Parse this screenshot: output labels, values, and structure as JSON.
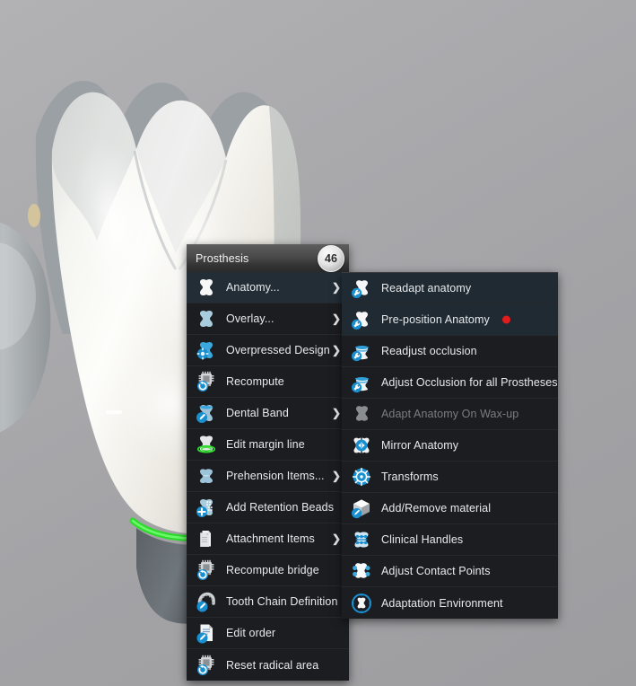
{
  "app": {
    "scene_description": "3D dental CAD viewport showing a molar crown restoration with green margin line",
    "background_color": "#a9a9ac",
    "margin_line_color": "#2ddb2d",
    "crown_color": "#f2f1ec"
  },
  "context_menu": {
    "header": {
      "title": "Prosthesis",
      "tooth_number": "46"
    },
    "items": [
      {
        "label": "Anatomy...",
        "icon": "tooth-white-icon",
        "submenu": true,
        "state": "highlighted"
      },
      {
        "label": "Overlay...",
        "icon": "tooth-blue-icon",
        "submenu": true,
        "state": "normal"
      },
      {
        "label": "Overpressed Design",
        "icon": "tooth-gear-icon",
        "submenu": true,
        "state": "normal"
      },
      {
        "label": "Recompute",
        "icon": "chip-refresh-icon",
        "submenu": false,
        "state": "normal"
      },
      {
        "label": "Dental Band",
        "icon": "tooth-pencil-icon",
        "submenu": true,
        "state": "normal"
      },
      {
        "label": "Edit margin line",
        "icon": "tooth-margin-line-icon",
        "submenu": false,
        "state": "normal"
      },
      {
        "label": "Prehension Items...",
        "icon": "tooth-prehension-icon",
        "submenu": true,
        "state": "normal"
      },
      {
        "label": "Add Retention Beads",
        "icon": "tooth-beads-plus-icon",
        "submenu": false,
        "state": "normal"
      },
      {
        "label": "Attachment Items",
        "icon": "attachment-stack-icon",
        "submenu": true,
        "state": "normal"
      },
      {
        "label": "Recompute bridge",
        "icon": "chip-refresh-icon",
        "submenu": false,
        "state": "normal"
      },
      {
        "label": "Tooth Chain Definition",
        "icon": "chain-pencil-icon",
        "submenu": false,
        "state": "normal"
      },
      {
        "label": "Edit order",
        "icon": "document-pencil-icon",
        "submenu": false,
        "state": "normal"
      },
      {
        "label": "Reset radical area",
        "icon": "chip-refresh-icon",
        "submenu": false,
        "state": "normal"
      }
    ]
  },
  "submenu": {
    "parent": "Anatomy...",
    "items": [
      {
        "label": "Readapt anatomy",
        "icon": "tooth-wrench-icon",
        "state": "highlighted",
        "marker": false
      },
      {
        "label": "Pre-position Anatomy",
        "icon": "tooth-wrench-icon",
        "state": "highlighted",
        "marker": true,
        "marker_color": "#e21b1b"
      },
      {
        "label": "Readjust occlusion",
        "icon": "occlusion-wrench-icon",
        "state": "normal",
        "marker": false
      },
      {
        "label": "Adjust Occlusion for all Prostheses",
        "icon": "occlusion-wrench-icon",
        "state": "normal",
        "marker": false
      },
      {
        "label": "Adapt Anatomy On Wax-up",
        "icon": "tooth-gray-icon",
        "state": "disabled",
        "marker": false
      },
      {
        "label": "Mirror Anatomy",
        "icon": "mirror-arrows-icon",
        "state": "normal",
        "marker": false
      },
      {
        "label": "Transforms",
        "icon": "transform-target-icon",
        "state": "normal",
        "marker": false
      },
      {
        "label": "Add/Remove material",
        "icon": "cube-pencil-icon",
        "state": "normal",
        "marker": false
      },
      {
        "label": "Clinical Handles",
        "icon": "clinical-handles-icon",
        "state": "normal",
        "marker": false
      },
      {
        "label": "Adjust Contact Points",
        "icon": "contact-points-icon",
        "state": "normal",
        "marker": false
      },
      {
        "label": "Adaptation Environment",
        "icon": "adaptation-env-icon",
        "state": "normal",
        "marker": false
      }
    ]
  },
  "glyphs": {
    "submenu_arrow": "❯"
  }
}
